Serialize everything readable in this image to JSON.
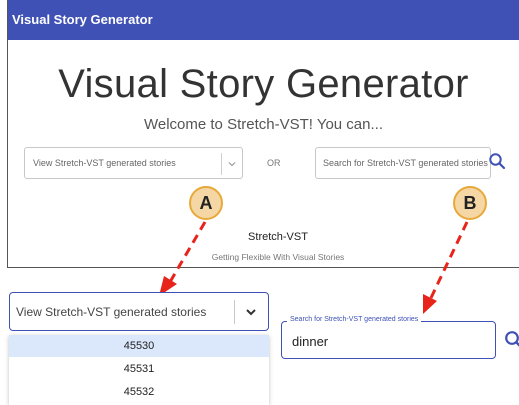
{
  "appbar": {
    "title": "Visual Story Generator"
  },
  "hero": {
    "title": "Visual Story Generator",
    "subtitle": "Welcome to Stretch-VST! You can..."
  },
  "controls": {
    "select_placeholder": "View Stretch-VST generated stories",
    "or_label": "OR",
    "search_placeholder": "Search for Stretch-VST generated stories"
  },
  "footer": {
    "title": "Stretch-VST",
    "subtitle": "Getting Flexible With Visual Stories"
  },
  "badges": {
    "a": "A",
    "b": "B"
  },
  "zoom": {
    "select_placeholder": "View Stretch-VST generated stories",
    "options": [
      "45530",
      "45531",
      "45532"
    ],
    "search_label": "Search for Stretch-VST generated stories",
    "search_value": "dinner"
  },
  "colors": {
    "appbar": "#3f51b5",
    "accent": "#3f51b5",
    "arrow": "#e8231a",
    "badge_fill": "#f4d7a4",
    "badge_border": "#e8a93a",
    "option_highlight": "#dbe8fb"
  },
  "icons": {
    "select_chevron": "chevron-down-icon",
    "search": "search-icon"
  }
}
